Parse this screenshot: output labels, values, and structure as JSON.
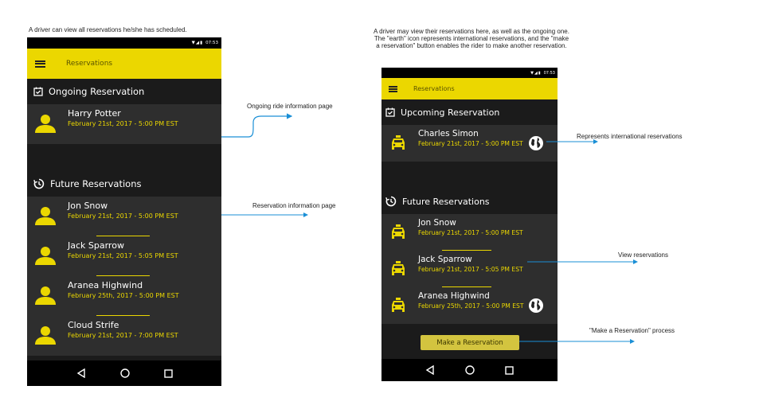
{
  "captions": {
    "left": "A driver can view all reservations he/she has scheduled.",
    "right": "A driver may view their reservations here, as well as the ongoing one. The \"earth\" icon represents international reservations, and the \"make a reservation\" button enables the rider to make another reservation."
  },
  "phone_a": {
    "time": "07:53",
    "title": "Reservations",
    "ongoing_header": "Ongoing Reservation",
    "ongoing": {
      "name": "Harry Potter",
      "date": "February 21st, 2017 - 5:00 PM EST"
    },
    "future_header": "Future Reservations",
    "future": [
      {
        "name": "Jon Snow",
        "date": "February 21st, 2017 - 5:00 PM EST"
      },
      {
        "name": "Jack Sparrow",
        "date": "February 21st, 2017 - 5:05 PM EST"
      },
      {
        "name": "Aranea Highwind",
        "date": "February 25th, 2017 - 5:00 PM EST"
      },
      {
        "name": "Cloud Strife",
        "date": "February 21st, 2017 - 7:00 PM EST"
      }
    ]
  },
  "phone_b": {
    "time": "07:53",
    "title": "Reservations",
    "upcoming_header": "Upcoming Reservation",
    "upcoming": {
      "name": "Charles Simon",
      "date": "February 21st, 2017 - 5:00 PM EST",
      "international": true
    },
    "future_header": "Future Reservations",
    "future": [
      {
        "name": "Jon Snow",
        "date": "February 21st, 2017 - 5:00 PM EST",
        "international": false
      },
      {
        "name": "Jack Sparrow",
        "date": "February 21st, 2017 - 5:05 PM EST",
        "international": false
      },
      {
        "name": "Aranea Highwind",
        "date": "February 25th, 2017 - 5:00 PM EST",
        "international": true
      }
    ],
    "button": "Make a Reservation"
  },
  "annotations": {
    "ongoing": "Ongoing ride information page",
    "reservation": "Reservation information page",
    "international": "Represents international reservations",
    "view": "View reservations",
    "make": "\"Make a Reservation\" process"
  },
  "colors": {
    "accent": "#ebd700",
    "background": "#1b1b1b",
    "row": "#2e2e2e",
    "connector": "#1a8fd6"
  },
  "icons": [
    "calendar-check-icon",
    "history-icon",
    "person-icon",
    "taxi-icon",
    "globe-icon",
    "menu-icon",
    "back-icon",
    "home-icon",
    "recents-icon",
    "wifi-icon",
    "signal-icon",
    "battery-icon"
  ]
}
